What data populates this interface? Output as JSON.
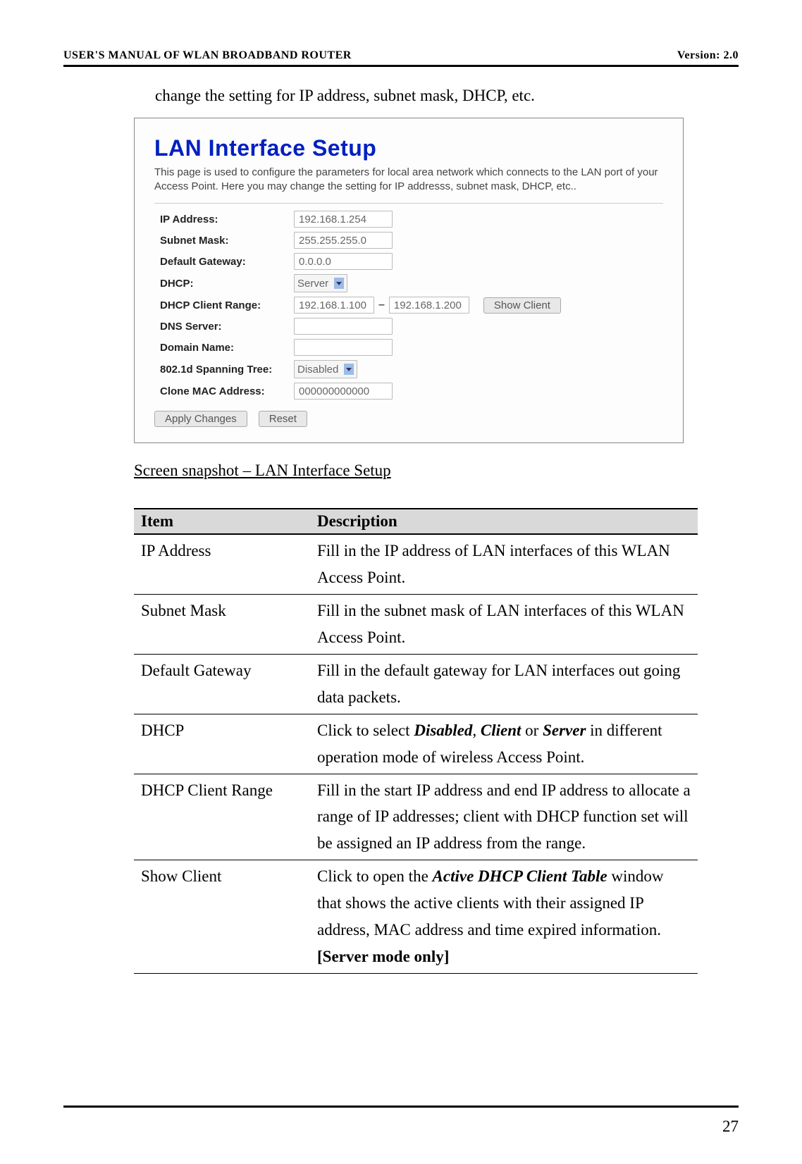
{
  "header": {
    "left": "USER'S MANUAL OF WLAN BROADBAND ROUTER",
    "right": "Version: 2.0"
  },
  "intro": "change the setting for IP address, subnet mask, DHCP, etc.",
  "shot": {
    "title": "LAN Interface Setup",
    "desc": "This page is used to configure the parameters for local area network which connects to the LAN port of your Access Point. Here you may change the setting for IP addresss, subnet mask, DHCP, etc..",
    "labels": {
      "ip": "IP Address:",
      "mask": "Subnet Mask:",
      "gateway": "Default Gateway:",
      "dhcp": "DHCP:",
      "range": "DHCP Client Range:",
      "dns": "DNS Server:",
      "domain": "Domain Name:",
      "stp": "802.1d Spanning Tree:",
      "clone": "Clone MAC Address:"
    },
    "values": {
      "ip": "192.168.1.254",
      "mask": "255.255.255.0",
      "gateway": "0.0.0.0",
      "dhcp": "Server",
      "range_start": "192.168.1.100",
      "range_end": "192.168.1.200",
      "dns": "",
      "domain": "",
      "stp": "Disabled",
      "clone": "000000000000"
    },
    "buttons": {
      "show_client": "Show Client",
      "apply": "Apply Changes",
      "reset": "Reset"
    }
  },
  "caption": "Screen snapshot – LAN Interface Setup",
  "table": {
    "head": {
      "item": "Item",
      "desc": "Description"
    },
    "rows": [
      {
        "item": "IP Address",
        "desc": "Fill in the IP address of LAN interfaces of this WLAN Access Point."
      },
      {
        "item": "Subnet Mask",
        "desc": "Fill in the subnet mask of LAN interfaces of this WLAN Access Point."
      },
      {
        "item": "Default Gateway",
        "desc": "Fill in the default gateway for LAN interfaces out going data packets."
      },
      {
        "item": "DHCP",
        "desc_html": "Click to select <b><i>Disabled</i></b>, <b><i>Client</i></b> or <b><i>Server</i></b> in different operation mode of wireless Access Point."
      },
      {
        "item": "DHCP Client Range",
        "desc": "Fill in the start IP address and end IP address to allocate a range of IP addresses; client with DHCP function set will be assigned an IP address from the range."
      },
      {
        "item": "Show Client",
        "desc_html": "Click to open the <b><i>Active DHCP Client Table</i></b> window that shows the active clients with their assigned IP address, MAC address and time expired information. <b>[Server mode only]</b>"
      }
    ]
  },
  "page_number": "27"
}
